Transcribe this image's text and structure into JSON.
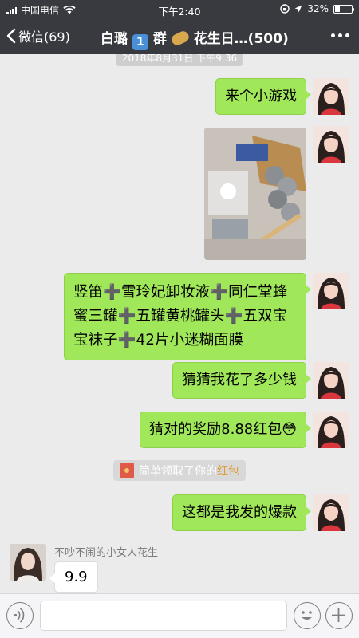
{
  "status_bar": {
    "carrier": "中国电信",
    "time": "下午2:40",
    "battery": "32%"
  },
  "nav": {
    "back_label": "微信(69)",
    "title_prefix": "白璐",
    "title_emoji1": "1",
    "title_mid": "群",
    "title_suffix": "花生日…(500)"
  },
  "chat": {
    "timestamp": "2018年8月31日 下午9:36",
    "messages": [
      {
        "text": "来个小游戏"
      },
      {
        "text": "竖笛➕雪玲妃卸妆液➕同仁堂蜂蜜三罐➕五罐黄桃罐头➕五双宝宝袜子➕42片小迷糊面膜"
      },
      {
        "text": "猜猜我花了多少钱"
      },
      {
        "text": "猜对的奖励8.88红包😳"
      },
      {
        "text": "这都是我发的爆款"
      }
    ],
    "system_note": {
      "text": "简单领取了你的",
      "link": "红包"
    },
    "incoming": {
      "sender": "不吵不闹的小女人花生",
      "text": "9.9"
    }
  },
  "colors": {
    "nav_bg": "#393a3f",
    "chat_bg": "#ebebeb",
    "bubble_green": "#a0e75a",
    "link_orange": "#e09b36"
  }
}
